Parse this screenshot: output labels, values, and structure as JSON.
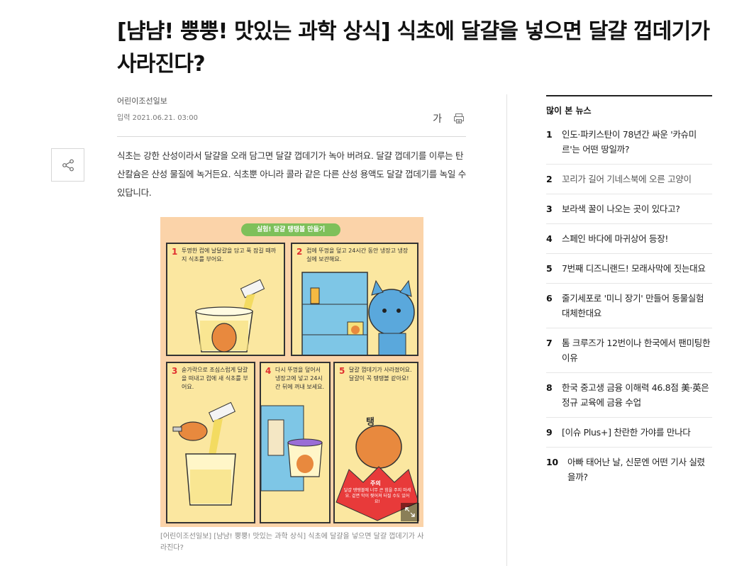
{
  "article": {
    "title": "[냠냠! 뿡뿡! 맛있는 과학 상식] 식초에 달걀을 넣으면 달걀 껍데기가 사라진다?",
    "press": "어린이조선일보",
    "date": "입력 2021.06.21. 03:00",
    "font_size_label": "가",
    "body": "식초는 강한 산성이라서 달걀을 오래 담그면 달걀 껍데기가 녹아 버려요. 달걀 껍데기를 이루는 탄산칼슘은 산성 물질에 녹거든요. 식초뿐 아니라 콜라 같은 다른 산성 용액도 달걀 껍데기를 녹일 수 있답니다.",
    "caption": "[어린이조선일보] [냠냠! 뿡뿡! 맛있는 과학 상식] 식초에 달걀을 넣으면 달걀 껍데기가 사라진다?"
  },
  "figure": {
    "banner": "실험! 달걀 탱탱볼 만들기",
    "steps": [
      {
        "num": "1",
        "text": "투명한 컵에 날달걀을 담고 푹 잠길 때까지 식초를 부어요."
      },
      {
        "num": "2",
        "text": "컵에 뚜껑을 덮고 24시간 동안 냉장고 냉장실에 보관해요."
      },
      {
        "num": "3",
        "text": "숟가락으로 조심스럽게 달걀을 떠내고 컵에 새 식초를 부어요."
      },
      {
        "num": "4",
        "text": "다시 뚜껑을 덮어서 냉장고에 넣고 24시간 뒤에 꺼내 보세요."
      },
      {
        "num": "5",
        "text": "달걀 껍데기가 사라졌어요. 달걀이 꼭 탱탱볼 같아요!"
      }
    ],
    "sound": "탱",
    "warning_title": "주의",
    "warning_text": "달걀 탱탱볼에 너무 큰 힘을 주지 마세요. 겉면 막이 찢어져 터질 수도 있어요!"
  },
  "sidebar": {
    "title": "많이 본 뉴스",
    "items": [
      {
        "rank": "1",
        "text": "인도·파키스탄이 78년간 싸운 '카슈미르'는 어떤 땅일까?"
      },
      {
        "rank": "2",
        "text": "꼬리가 길어 기네스북에 오른 고양이"
      },
      {
        "rank": "3",
        "text": "보라색 꿀이 나오는 곳이 있다고?"
      },
      {
        "rank": "4",
        "text": "스페인 바다에 마귀상어 등장!"
      },
      {
        "rank": "5",
        "text": "7번째 디즈니랜드! 모래사막에 짓는대요"
      },
      {
        "rank": "6",
        "text": "줄기세포로 '미니 장기' 만들어 동물실험 대체한대요"
      },
      {
        "rank": "7",
        "text": "톰 크루즈가 12번이나 한국에서 팬미팅한 이유"
      },
      {
        "rank": "8",
        "text": "한국 중고생 금융 이해력 46.8점 美·英은 정규 교육에 금융 수업"
      },
      {
        "rank": "9",
        "text": "[이슈 Plus+] 찬란한 가야를 만나다"
      },
      {
        "rank": "10",
        "text": "아빠 태어난 날, 신문엔 어떤 기사 실렸을까?"
      }
    ]
  },
  "icons": {
    "share": "share-icon",
    "print": "print-icon",
    "expand": "expand-icon"
  },
  "colors": {
    "figure_bg": "#fbd3a9",
    "panel_bg": "#fbe7a0",
    "banner": "#7ec05a",
    "step_number": "#e03030",
    "warning": "#e83a3a"
  }
}
